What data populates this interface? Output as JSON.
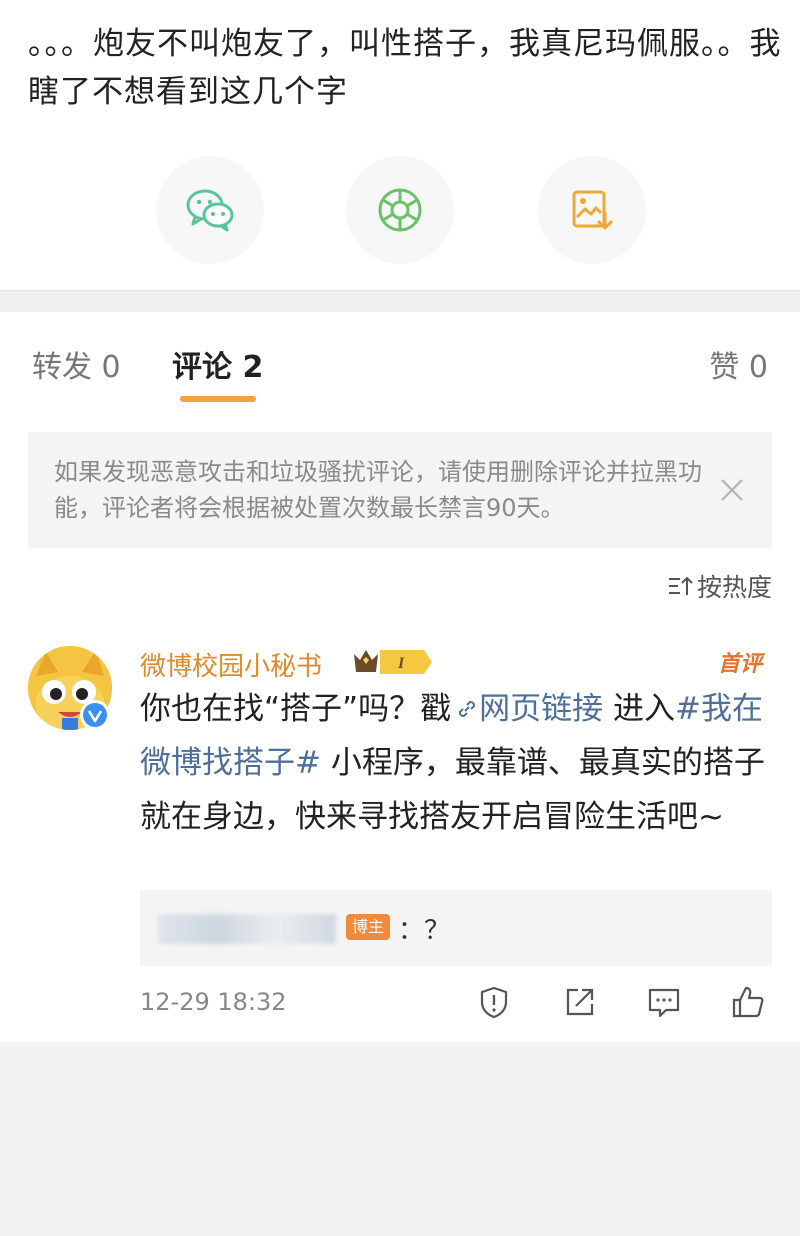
{
  "post": {
    "text": "。。。炮友不叫炮友了，叫性搭子，我真尼玛佩服。。我瞎了不想看到这几个字",
    "share_buttons": [
      {
        "icon": "wechat-icon",
        "color": "#5bc59a"
      },
      {
        "icon": "moments-icon",
        "color": "#6cc06a"
      },
      {
        "icon": "save-image-icon",
        "color": "#f0a735"
      }
    ]
  },
  "tabs": {
    "repost": "转发 0",
    "comments": "评论 2",
    "likes": "赞 0"
  },
  "notice": {
    "text": "如果发现恶意攻击和垃圾骚扰评论，请使用删除评论并拉黑功能，评论者将会根据被处置次数最长禁言90天。"
  },
  "sort": {
    "label": "按热度"
  },
  "comment": {
    "username": "微博校园小秘书",
    "badge_level": "I",
    "top_tag": "首评",
    "text_before": "你也在找“搭子”吗？戳",
    "link_label": "网页链接",
    "text_middle": " 进入",
    "hashtag": "#我在微博找搭子#",
    "text_after": " 小程序，最靠谱、最真实的搭子就在身边，快来寻找搭友开启冒险生活吧~",
    "reply": {
      "tag": "博主",
      "text": "：？"
    },
    "time": "12-29 18:32"
  },
  "colors": {
    "accent": "#f2a33a",
    "username": "#e08a2c",
    "link": "#4e6f9a"
  }
}
